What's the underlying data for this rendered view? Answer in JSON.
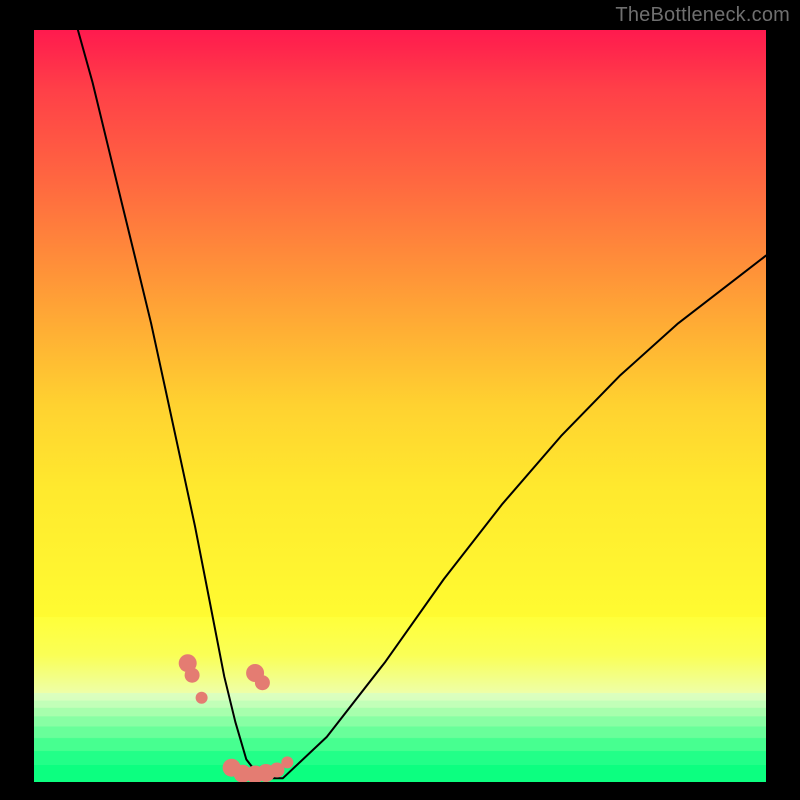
{
  "watermark": "TheBottleneck.com",
  "chart_data": {
    "type": "line",
    "title": "",
    "xlabel": "",
    "ylabel": "",
    "xlim": [
      0,
      100
    ],
    "ylim": [
      0,
      100
    ],
    "grid": false,
    "legend": false,
    "series": [
      {
        "name": "bottleneck-curve",
        "x": [
          6,
          8,
          10,
          12,
          14,
          16,
          18,
          20,
          22,
          24,
          26,
          27.5,
          29,
          31,
          34,
          40,
          48,
          56,
          64,
          72,
          80,
          88,
          96,
          100
        ],
        "y": [
          100,
          93,
          85,
          77,
          69,
          61,
          52,
          43,
          34,
          24,
          14,
          8,
          3,
          0.5,
          0.5,
          6,
          16,
          27,
          37,
          46,
          54,
          61,
          67,
          70
        ]
      }
    ],
    "markers": [
      {
        "x": 21.0,
        "y": 15.8,
        "size": "big"
      },
      {
        "x": 21.6,
        "y": 14.2,
        "size": "med"
      },
      {
        "x": 22.9,
        "y": 11.2,
        "size": "sm"
      },
      {
        "x": 27.0,
        "y": 1.9,
        "size": "big"
      },
      {
        "x": 28.5,
        "y": 1.1,
        "size": "big"
      },
      {
        "x": 30.2,
        "y": 1.0,
        "size": "big"
      },
      {
        "x": 31.7,
        "y": 1.2,
        "size": "big"
      },
      {
        "x": 33.2,
        "y": 1.6,
        "size": "med"
      },
      {
        "x": 34.6,
        "y": 2.6,
        "size": "sm"
      },
      {
        "x": 30.2,
        "y": 14.5,
        "size": "big"
      },
      {
        "x": 31.2,
        "y": 13.2,
        "size": "med"
      }
    ],
    "background_bands": [
      {
        "name": "red-to-yellow",
        "from_pct": 0,
        "to_pct": 78
      },
      {
        "name": "yellow-bright",
        "from_pct": 78,
        "to_pct": 88.2
      },
      {
        "name": "green-stripes",
        "from_pct": 88.2,
        "to_pct": 97.8
      },
      {
        "name": "green-solid",
        "from_pct": 97.8,
        "to_pct": 100
      }
    ]
  }
}
